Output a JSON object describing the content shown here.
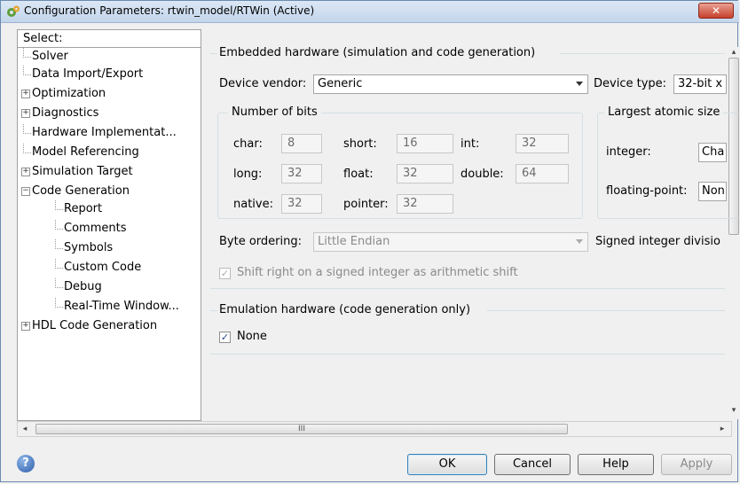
{
  "window": {
    "title": "Configuration Parameters: rtwin_model/RTWin (Active)",
    "close_glyph": "✕"
  },
  "tree": {
    "select_label": "Select:",
    "items": [
      {
        "label": "Solver"
      },
      {
        "label": "Data Import/Export"
      },
      {
        "label": "Optimization"
      },
      {
        "label": "Diagnostics"
      },
      {
        "label": "Hardware Implementat..."
      },
      {
        "label": "Model Referencing"
      },
      {
        "label": "Simulation Target"
      },
      {
        "label": "Code Generation"
      },
      {
        "label": "Report"
      },
      {
        "label": "Comments"
      },
      {
        "label": "Symbols"
      },
      {
        "label": "Custom Code"
      },
      {
        "label": "Debug"
      },
      {
        "label": "Real-Time Window..."
      },
      {
        "label": "HDL Code Generation"
      }
    ],
    "expander_plus": "+",
    "expander_minus": "−"
  },
  "embedded": {
    "title": "Embedded hardware (simulation and code generation)",
    "device_vendor_label": "Device vendor:",
    "device_vendor_value": "Generic",
    "device_type_label": "Device type:",
    "device_type_value": "32-bit x",
    "bits": {
      "title": "Number of bits",
      "char_label": "char:",
      "char_value": "8",
      "short_label": "short:",
      "short_value": "16",
      "int_label": "int:",
      "int_value": "32",
      "long_label": "long:",
      "long_value": "32",
      "float_label": "float:",
      "float_value": "32",
      "double_label": "double:",
      "double_value": "64",
      "native_label": "native:",
      "native_value": "32",
      "pointer_label": "pointer:",
      "pointer_value": "32"
    },
    "atomic": {
      "title": "Largest atomic size",
      "integer_label": "integer:",
      "integer_value": "Cha",
      "floating_label": "floating-point:",
      "floating_value": "Non"
    },
    "byte_ordering_label": "Byte ordering:",
    "byte_ordering_value": "Little Endian",
    "signed_division_label": "Signed integer divisio",
    "shift_label": "Shift right on a signed integer as arithmetic shift",
    "shift_checked": true
  },
  "emulation": {
    "title": "Emulation hardware (code generation only)",
    "none_label": "None",
    "none_checked": true
  },
  "buttons": {
    "ok": "OK",
    "cancel": "Cancel",
    "help": "Help",
    "apply": "Apply"
  },
  "help_glyph": "?",
  "scroll": {
    "grip": "III",
    "left": "◂",
    "right": "▸",
    "up": "▴",
    "down": "▾"
  },
  "check_glyph": "✓"
}
